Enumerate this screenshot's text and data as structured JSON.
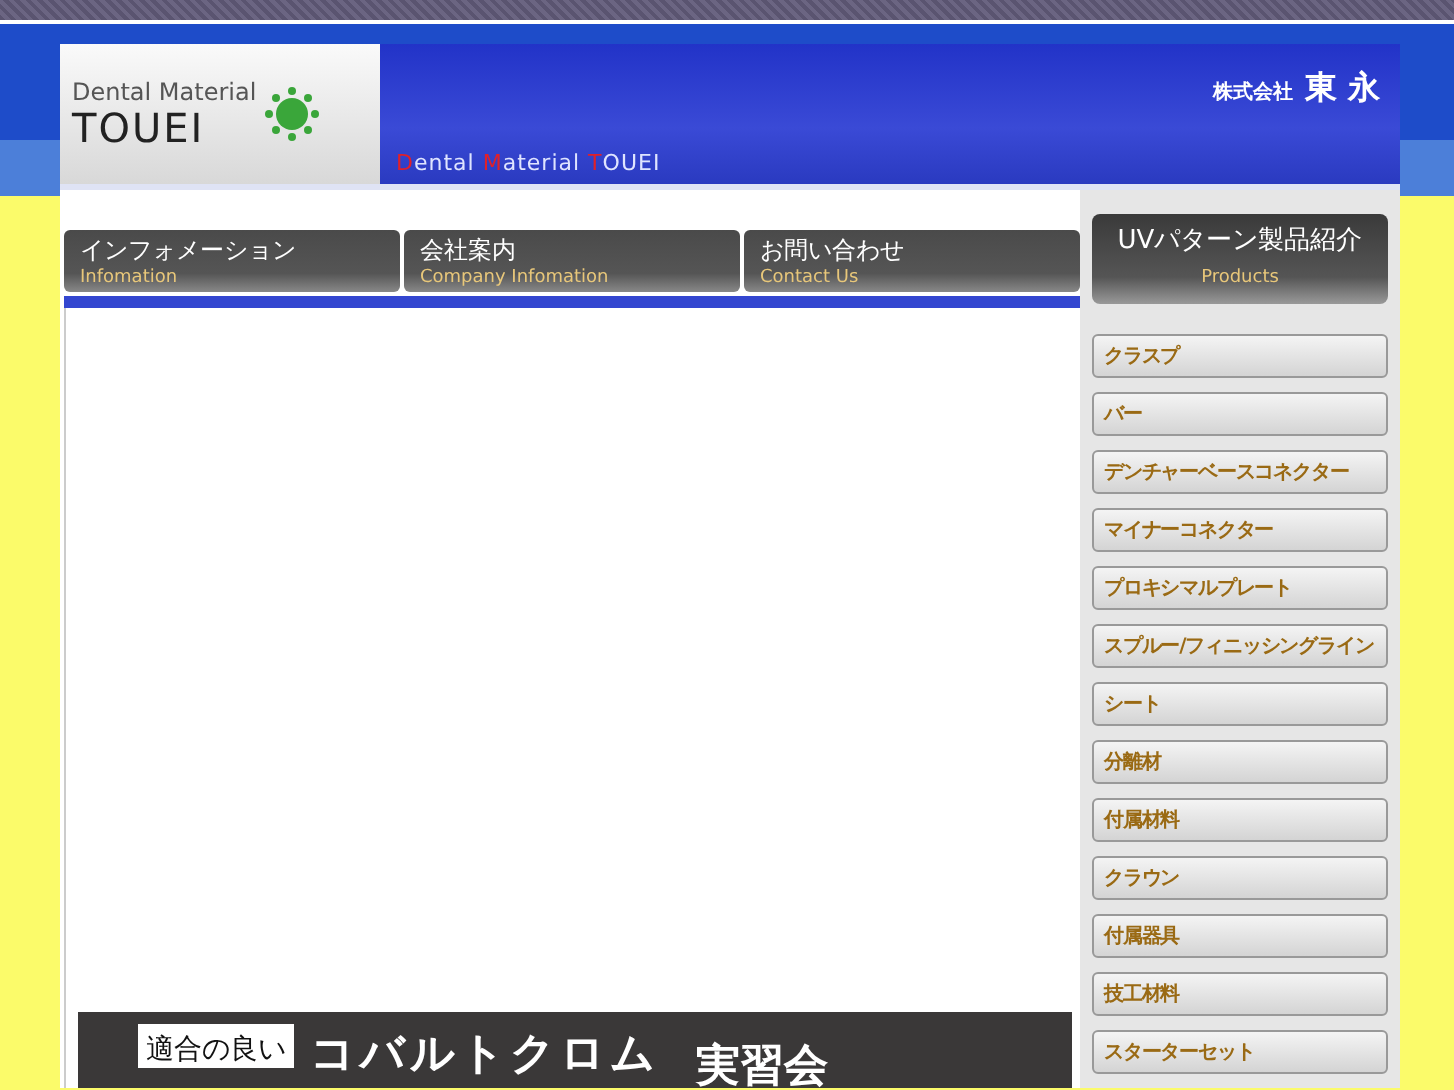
{
  "header": {
    "logo_line1": "Dental Material",
    "logo_line2": "TOUEI",
    "tagline": "Dental Material TOUEI",
    "company_prefix": "株式会社",
    "company_name": "東 永"
  },
  "nav_tabs": [
    {
      "label": "インフォメーション",
      "sublabel": "Infomation"
    },
    {
      "label": "会社案内",
      "sublabel": "Company Infomation"
    },
    {
      "label": "お問い合わせ",
      "sublabel": "Contact Us"
    }
  ],
  "sidebar": {
    "title": "UVパターン製品紹介",
    "subtitle": "Products",
    "items": [
      "クラスプ",
      "バー",
      "デンチャーベースコネクター",
      "マイナーコネクター",
      "プロキシマルプレート",
      "スプルー/フィニッシングライン",
      "シート",
      "分離材",
      "付属材料",
      "クラウン",
      "付属器具",
      "技工材料",
      "スターターセット"
    ]
  },
  "banner": {
    "tag": "適合の良い",
    "headline": "コバルトクロム",
    "suffix": "実習会"
  }
}
